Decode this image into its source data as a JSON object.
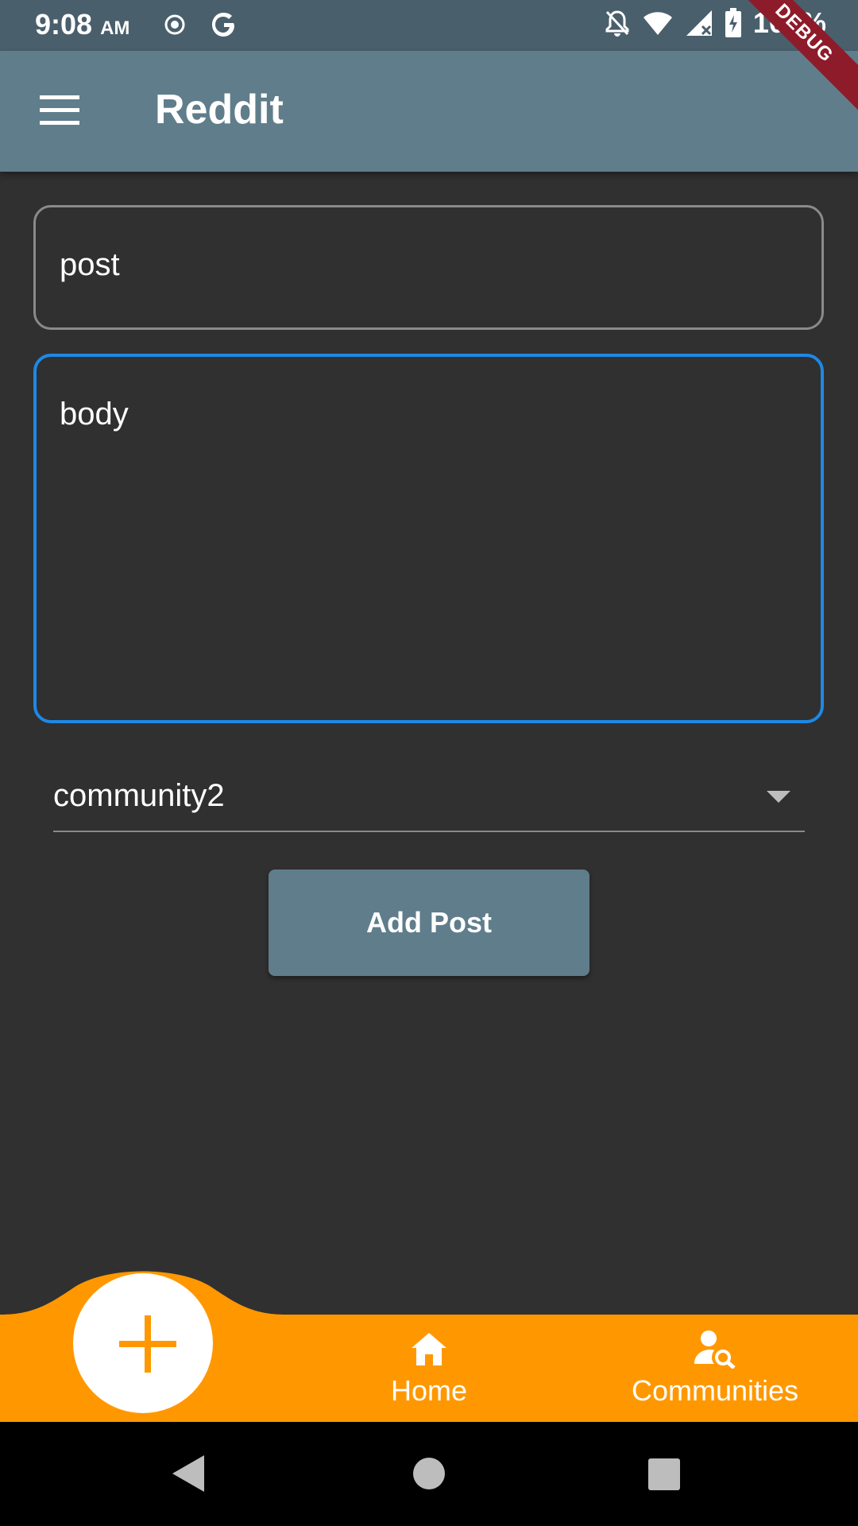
{
  "status_bar": {
    "time": "9:08",
    "ampm": "AM",
    "battery": "100%",
    "icons": [
      "target-icon",
      "google-icon",
      "bell-off-icon",
      "wifi-icon",
      "signal-icon",
      "battery-charging-icon"
    ]
  },
  "debug_banner": "DEBUG",
  "app_bar": {
    "title": "Reddit",
    "menu_icon": "hamburger-menu-icon"
  },
  "form": {
    "post_value": "post",
    "body_value": "body",
    "community_selected": "community2",
    "add_post_label": "Add Post"
  },
  "colors": {
    "app_bar": "#607d8b",
    "status_bar": "#4a5f6c",
    "background": "#303030",
    "focused_border": "#1e88e5",
    "bottom_bar": "#ff9800",
    "fab_icon": "#ff9800"
  },
  "bottom_nav": {
    "fab_icon": "plus-icon",
    "items": [
      {
        "label": "Home",
        "icon": "home-icon"
      },
      {
        "label": "Communities",
        "icon": "person-search-icon"
      }
    ]
  },
  "system_nav": {
    "icons": [
      "back-icon",
      "home-circle-icon",
      "recents-icon"
    ]
  }
}
